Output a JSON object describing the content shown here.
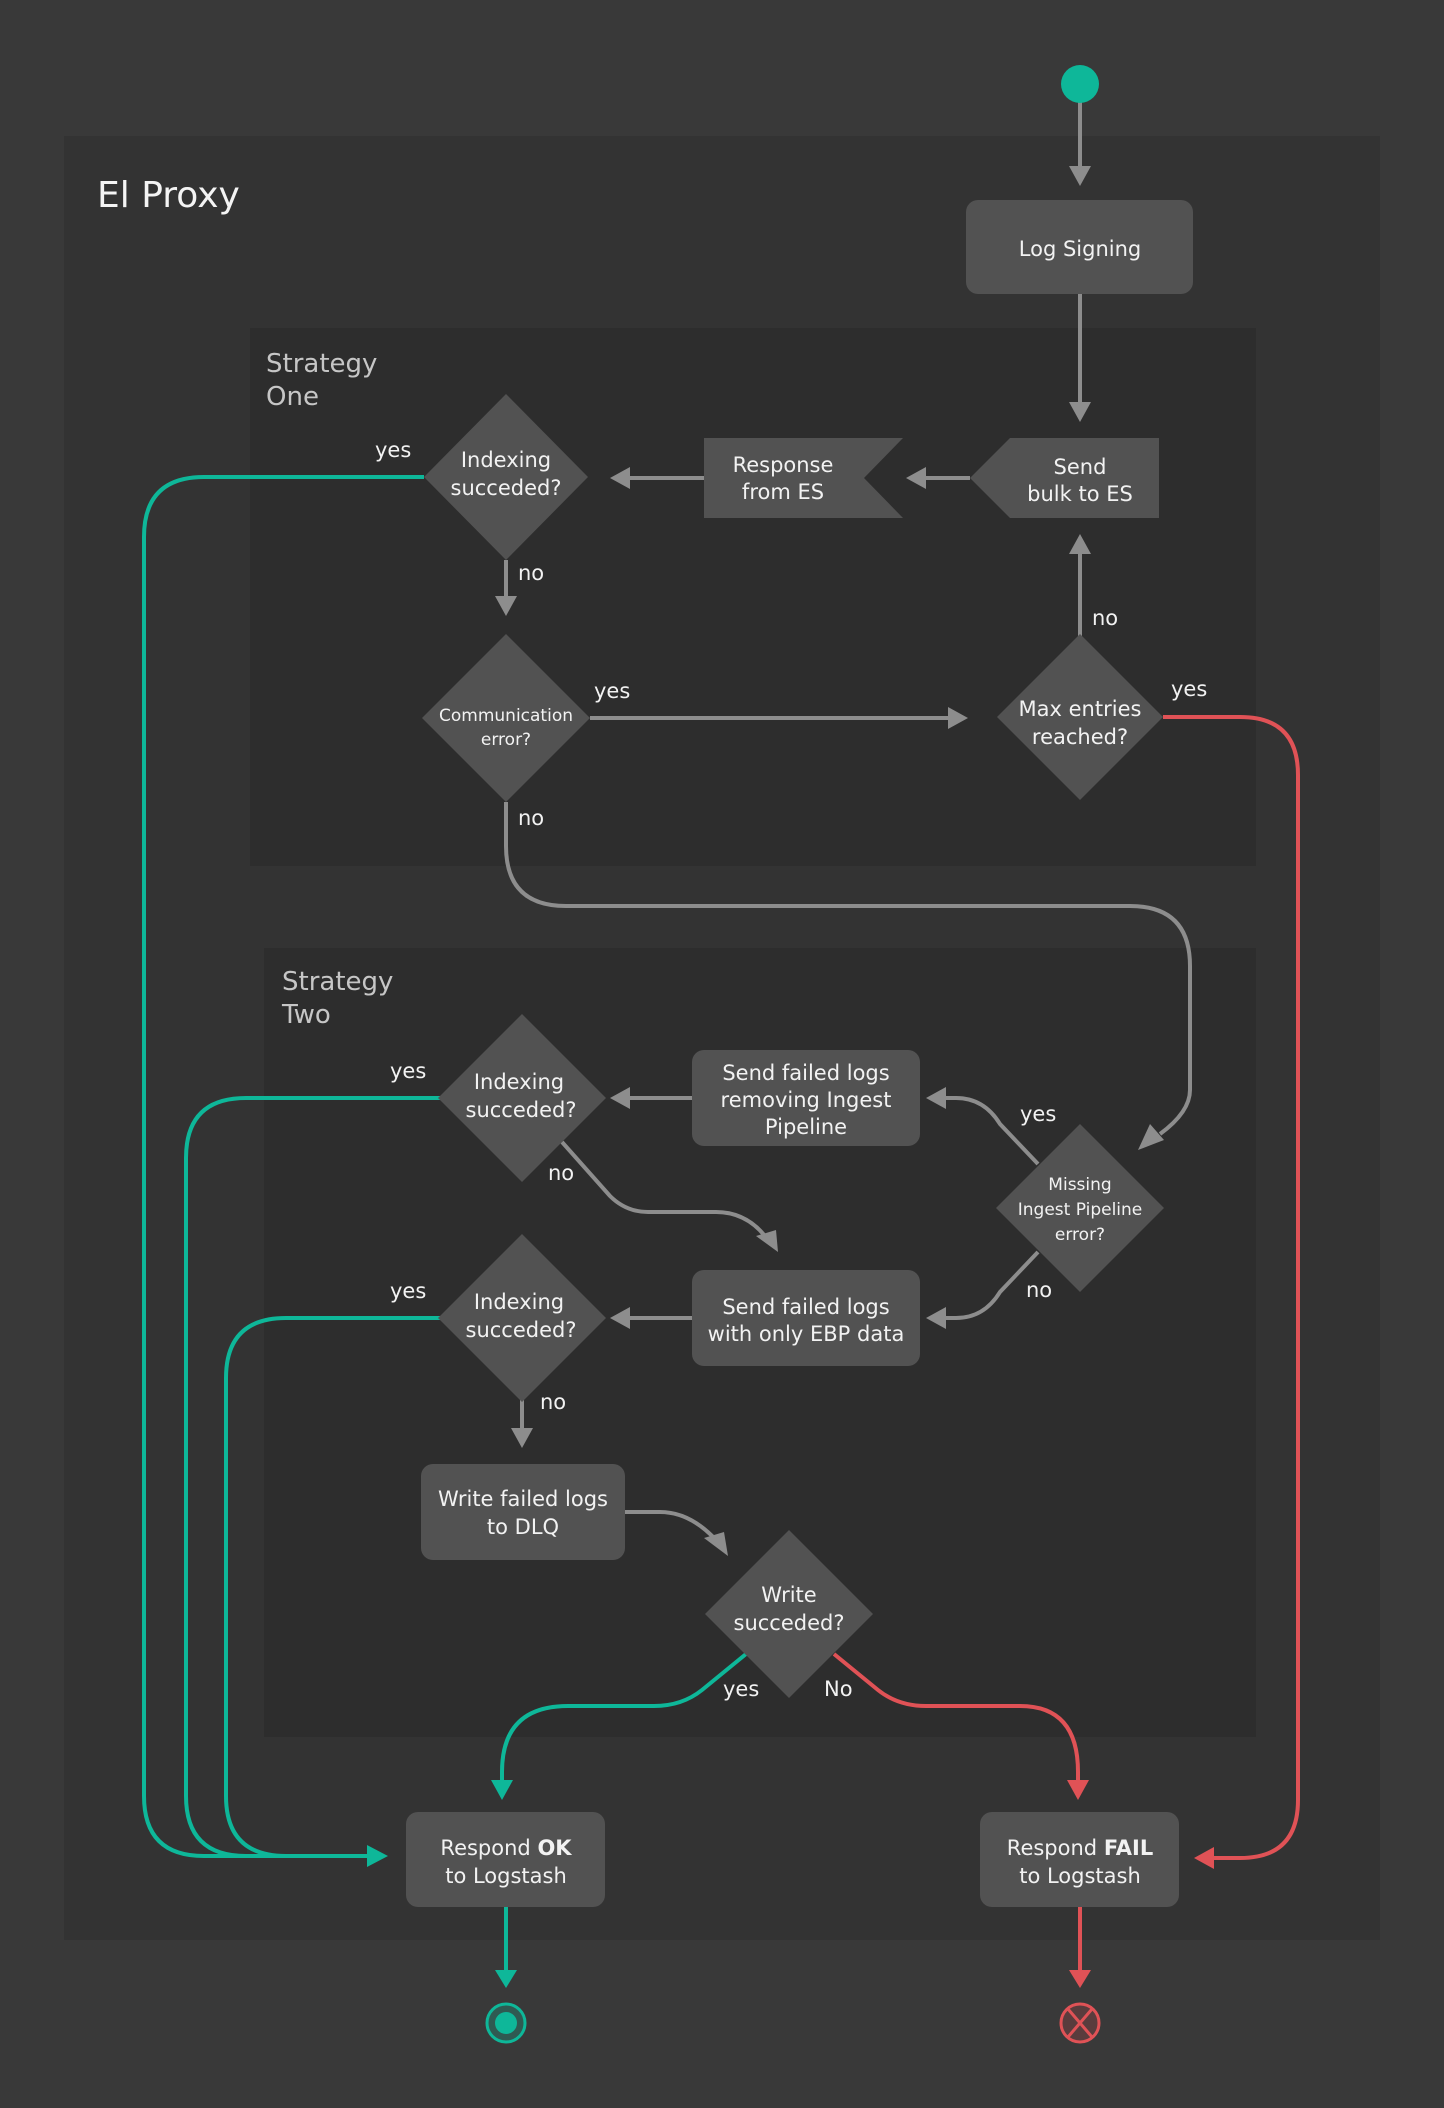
{
  "diagram": {
    "title": "El Proxy",
    "colors": {
      "background": "#393939",
      "container": "#333333",
      "strategy_box": "#2d2d2d",
      "node": "#525252",
      "neutral_edge": "#8d8d8d",
      "success": "#0eb799",
      "failure": "#e05256",
      "text": "#f2f2f2"
    },
    "groups": {
      "strategy_one": {
        "line1": "Strategy",
        "line2": "One"
      },
      "strategy_two": {
        "line1": "Strategy",
        "line2": "Two"
      }
    },
    "nodes": {
      "start": {
        "type": "initial-node"
      },
      "log_signing": {
        "label": "Log Signing"
      },
      "send_bulk": {
        "line1": "Send",
        "line2": "bulk to ES"
      },
      "response_es": {
        "line1": "Response",
        "line2": "from ES"
      },
      "indexing_1": {
        "line1": "Indexing",
        "line2": "succeded?"
      },
      "comm_error": {
        "line1": "Communication",
        "line2": "error?"
      },
      "max_entries": {
        "line1": "Max entries",
        "line2": "reached?"
      },
      "missing_pipeline": {
        "line1": "Missing",
        "line2": "Ingest Pipeline",
        "line3": "error?"
      },
      "send_removing": {
        "line1": "Send failed logs",
        "line2": "removing Ingest",
        "line3": "Pipeline"
      },
      "indexing_2": {
        "line1": "Indexing",
        "line2": "succeded?"
      },
      "send_ebp": {
        "line1": "Send failed logs",
        "line2": "with only EBP data"
      },
      "indexing_3": {
        "line1": "Indexing",
        "line2": "succeded?"
      },
      "write_dlq": {
        "line1": "Write failed logs",
        "line2": "to DLQ"
      },
      "write_succeeded": {
        "line1": "Write",
        "line2": "succeded?"
      },
      "respond_ok": {
        "prefix": "Respond ",
        "emphasis": "OK",
        "line2": "to Logstash"
      },
      "respond_fail": {
        "prefix": "Respond ",
        "emphasis": "FAIL",
        "line2": "to Logstash"
      },
      "end_ok": {
        "type": "final-node"
      },
      "end_fail": {
        "type": "flow-final-node"
      }
    },
    "edge_labels": {
      "indexing_1_yes": "yes",
      "indexing_1_no": "no",
      "comm_error_yes": "yes",
      "comm_error_no": "no",
      "max_entries_no": "no",
      "max_entries_yes": "yes",
      "missing_yes": "yes",
      "missing_no": "no",
      "indexing_2_yes": "yes",
      "indexing_2_no": "no",
      "indexing_3_yes": "yes",
      "indexing_3_no": "no",
      "write_yes": "yes",
      "write_no": "No"
    }
  }
}
